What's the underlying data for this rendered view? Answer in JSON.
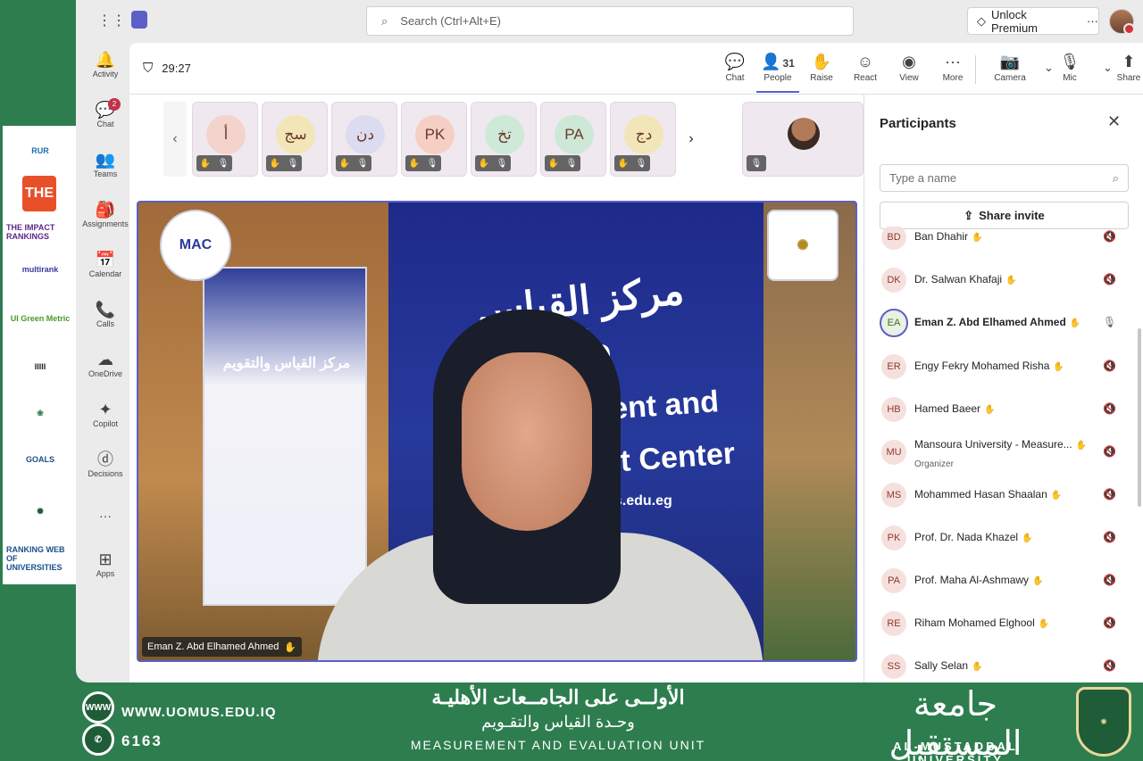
{
  "app": {
    "search_placeholder": "Search (Ctrl+Alt+E)",
    "unlock_premium": "Unlock Premium",
    "more_dots": "···",
    "apps_icon": "grid-icon",
    "teams_icon": "teams-logo-icon"
  },
  "rail": [
    {
      "label": "Activity",
      "icon": "bell-icon",
      "glyph": "🔔"
    },
    {
      "label": "Chat",
      "icon": "chat-icon",
      "glyph": "💬",
      "badge": "2"
    },
    {
      "label": "Teams",
      "icon": "teams-icon",
      "glyph": "👥"
    },
    {
      "label": "Assignments",
      "icon": "assignments-icon",
      "glyph": "🎒"
    },
    {
      "label": "Calendar",
      "icon": "calendar-icon",
      "glyph": "📅"
    },
    {
      "label": "Calls",
      "icon": "phone-icon",
      "glyph": "📞"
    },
    {
      "label": "OneDrive",
      "icon": "cloud-icon",
      "glyph": "☁"
    },
    {
      "label": "Copilot",
      "icon": "copilot-icon",
      "glyph": "✦"
    },
    {
      "label": "Decisions",
      "icon": "decisions-icon",
      "glyph": "ⓓ"
    },
    {
      "label": "···",
      "icon": "more-icon",
      "glyph": ""
    },
    {
      "label": "Apps",
      "icon": "plus-icon",
      "glyph": "⊞"
    }
  ],
  "meeting": {
    "timer": "29:27",
    "people_count": "31",
    "tools": [
      {
        "label": "Chat",
        "icon": "chat-icon",
        "glyph": "💬"
      },
      {
        "label": "People",
        "icon": "people-icon",
        "glyph": "👤"
      },
      {
        "label": "Raise",
        "icon": "hand-icon",
        "glyph": "✋"
      },
      {
        "label": "React",
        "icon": "smile-icon",
        "glyph": "☺"
      },
      {
        "label": "View",
        "icon": "view-icon",
        "glyph": "◉"
      },
      {
        "label": "More",
        "icon": "more-icon",
        "glyph": "···"
      },
      {
        "label": "Camera",
        "icon": "camera-off-icon",
        "glyph": "📷"
      },
      {
        "label": "Mic",
        "icon": "mic-off-icon",
        "glyph": "🎙"
      },
      {
        "label": "Share",
        "icon": "share-icon",
        "glyph": "⬆"
      },
      {
        "label": "Leave",
        "icon": "leave-icon",
        "glyph": "☎"
      }
    ]
  },
  "thumbnails": [
    {
      "initials": "أ",
      "bg": "#f4d3cc"
    },
    {
      "initials": "سج",
      "bg": "#f2e6b8"
    },
    {
      "initials": "دن",
      "bg": "#dcdcf0"
    },
    {
      "initials": "PK",
      "bg": "#f6cfc4"
    },
    {
      "initials": "تخ",
      "bg": "#cfe9d8"
    },
    {
      "initials": "PA",
      "bg": "#cde8d6"
    },
    {
      "initials": "دج",
      "bg": "#f2e6b8"
    }
  ],
  "video": {
    "speaker_name": "Eman Z. Abd Elhamed Ahmed",
    "banner_ar": "مركز القياس والتقويم",
    "wall_ar": "مركز القياس والتقويم",
    "wall_en1": "ement and",
    "wall_en2": "ent Center",
    "wall_url": "mans.edu.eg",
    "mac_logo": "MAC"
  },
  "participants": {
    "title": "Participants",
    "search_placeholder": "Type a name",
    "share_invite": "Share invite",
    "list": [
      {
        "initials": "BD",
        "name": "Ban Dhahir",
        "sub": "",
        "active": false
      },
      {
        "initials": "DK",
        "name": "Dr. Salwan Khafaji",
        "sub": "",
        "active": false
      },
      {
        "initials": "EA",
        "name": "Eman Z. Abd Elhamed Ahmed",
        "sub": "",
        "active": true
      },
      {
        "initials": "ER",
        "name": "Engy Fekry Mohamed Risha",
        "sub": "",
        "active": false
      },
      {
        "initials": "HB",
        "name": "Hamed Baeer",
        "sub": "",
        "active": false
      },
      {
        "initials": "MU",
        "name": "Mansoura University - Measure...",
        "sub": "Organizer",
        "active": false
      },
      {
        "initials": "MS",
        "name": "Mohammed Hasan Shaalan",
        "sub": "",
        "active": false
      },
      {
        "initials": "PK",
        "name": "Prof. Dr. Nada Khazel",
        "sub": "",
        "active": false
      },
      {
        "initials": "PA",
        "name": "Prof. Maha Al-Ashmawy",
        "sub": "",
        "active": false
      },
      {
        "initials": "RE",
        "name": "Riham Mohamed Elghool",
        "sub": "",
        "active": false
      },
      {
        "initials": "SS",
        "name": "Sally Selan",
        "sub": "",
        "active": false
      }
    ]
  },
  "logos": [
    {
      "text": "RUR",
      "color": "#1a6fb5"
    },
    {
      "text": "THE",
      "color": "#ffffff",
      "bg": "#e8502a"
    },
    {
      "text": "THE IMPACT RANKINGS",
      "color": "#5b2a86"
    },
    {
      "text": "multirank",
      "color": "#3a3a9a"
    },
    {
      "text": "UI Green Metric",
      "color": "#4a9a2a"
    },
    {
      "text": "IIIII",
      "color": "#222222"
    },
    {
      "text": "❀",
      "color": "#2e7d4f"
    },
    {
      "text": "GOALS",
      "color": "#1a4f8a"
    },
    {
      "text": "✺",
      "color": "#1f5c38"
    },
    {
      "text": "RANKING WEB OF UNIVERSITIES",
      "color": "#1a4f8a"
    }
  ],
  "branding": {
    "website": "WWW.UOMUS.EDU.IQ",
    "phone": "6163",
    "www_badge": "WWW",
    "ar_line1": "الأولــى على الجامــعات الأهليـة",
    "ar_line2": "وحـدة القياس والتقـويم",
    "en_line": "MEASUREMENT AND EVALUATION UNIT",
    "uni_ar": "جامعة المستقبل",
    "uni_en": "AL-MUSTAQBAL UNIVERSITY"
  }
}
